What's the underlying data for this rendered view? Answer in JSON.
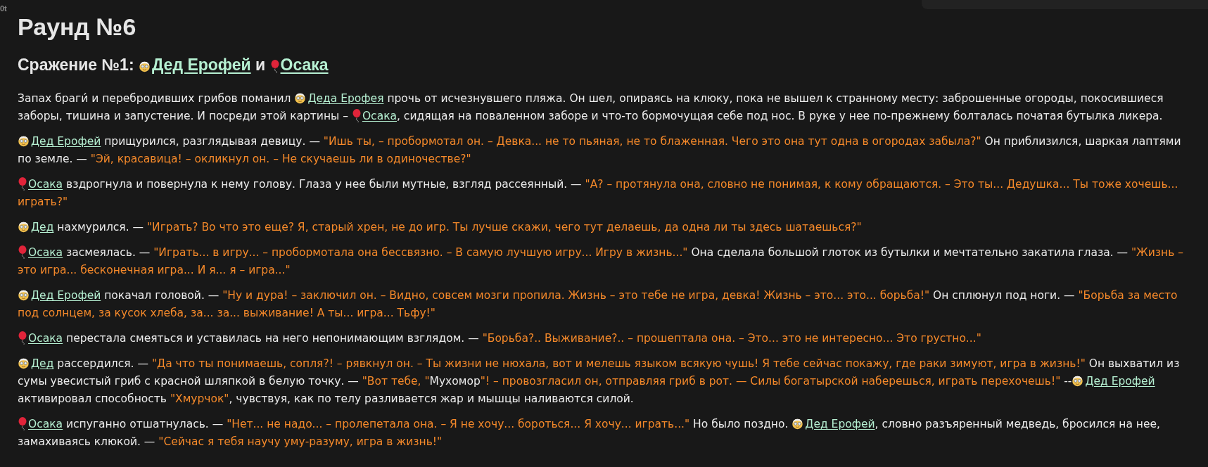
{
  "corner_text": "0t",
  "title": "Раунд №6",
  "battle": {
    "label": "Сражение №1:",
    "joiner": "и",
    "fighters": [
      {
        "name": "Дед Ерофей",
        "kind": "elder"
      },
      {
        "name": "Осака",
        "kind": "balloon"
      }
    ]
  },
  "paragraphs": [
    {
      "segments": [
        {
          "kind": "text",
          "text": "Запах браги́ и перебродивших грибов поманил "
        },
        {
          "kind": "elder",
          "text": "Деда Ерофея"
        },
        {
          "kind": "text",
          "text": " прочь от исчезнувшего пляжа. Он шел, опираясь на клюку, пока не вышел к странному месту: заброшенные огороды, покосившиеся заборы, тишина и запустение. И посреди этой картины – "
        },
        {
          "kind": "balloon",
          "text": "Осака"
        },
        {
          "kind": "text",
          "text": ", сидящая на поваленном заборе и что-то бормочущая себе под нос. В руке у нее по-прежнему болталась початая бутылка ликера."
        }
      ]
    },
    {
      "segments": [
        {
          "kind": "elder",
          "text": "Дед Ерофей"
        },
        {
          "kind": "text",
          "text": " прищурился, разглядывая девицу. — "
        },
        {
          "kind": "speech",
          "text": "\"Ишь ты, – пробормотал он. – Девка... не то пьяная, не то блаженная. Чего это она тут одна в огородах забыла?\""
        },
        {
          "kind": "text",
          "text": " Он приблизился, шаркая лаптями по земле. — "
        },
        {
          "kind": "speech",
          "text": "\"Эй, красавица! – окликнул он. – Не скучаешь ли в одиночестве?\""
        }
      ]
    },
    {
      "segments": [
        {
          "kind": "balloon",
          "text": "Осака"
        },
        {
          "kind": "text",
          "text": " вздрогнула и повернула к нему голову. Глаза у нее были мутные, взгляд рассеянный. — "
        },
        {
          "kind": "speech",
          "text": "\"А? – протянула она, словно не понимая, к кому обращаются. – Это ты... Дедушка... Ты тоже хочешь... играть?\""
        }
      ]
    },
    {
      "segments": [
        {
          "kind": "elder",
          "text": "Дед"
        },
        {
          "kind": "text",
          "text": " нахмурился. — "
        },
        {
          "kind": "speech",
          "text": "\"Играть? Во что это еще? Я, старый хрен, не до игр. Ты лучше скажи, чего тут делаешь, да одна ли ты здесь шатаешься?\""
        }
      ]
    },
    {
      "segments": [
        {
          "kind": "balloon",
          "text": "Осака"
        },
        {
          "kind": "text",
          "text": " засмеялась. — "
        },
        {
          "kind": "speech",
          "text": "\"Играть... в игру... – пробормотала она бессвязно. – В самую лучшую игру... Игру в жизнь...\""
        },
        {
          "kind": "text",
          "text": " Она сделала большой глоток из бутылки и мечтательно закатила глаза. — "
        },
        {
          "kind": "speech",
          "text": "\"Жизнь – это игра... бесконечная игра... И я... я – игра...\""
        }
      ]
    },
    {
      "segments": [
        {
          "kind": "elder",
          "text": "Дед Ерофей"
        },
        {
          "kind": "text",
          "text": " покачал головой. — "
        },
        {
          "kind": "speech",
          "text": "\"Ну и дура! – заключил он. – Видно, совсем мозги пропила. Жизнь – это тебе не игра, девка! Жизнь – это... это... борьба!\""
        },
        {
          "kind": "text",
          "text": " Он сплюнул под ноги. — "
        },
        {
          "kind": "speech",
          "text": "\"Борьба за место под солнцем, за кусок хлеба, за... за... выживание! А ты... игра... Тьфу!\""
        }
      ]
    },
    {
      "segments": [
        {
          "kind": "balloon",
          "text": "Осака"
        },
        {
          "kind": "text",
          "text": " перестала смеяться и уставилась на него непонимающим взглядом. — "
        },
        {
          "kind": "speech",
          "text": "\"Борьба?.. Выживание?.. – прошептала она. – Это... это не интересно... Это грустно...\""
        }
      ]
    },
    {
      "segments": [
        {
          "kind": "elder",
          "text": "Дед"
        },
        {
          "kind": "text",
          "text": " рассердился. — "
        },
        {
          "kind": "speech",
          "text": "\"Да что ты понимаешь, сопля?! – рявкнул он. – Ты жизни не нюхала, вот и мелешь языком всякую чушь! Я тебе сейчас покажу, где раки зимуют, игра в жизнь!\""
        },
        {
          "kind": "text",
          "text": " Он выхватил из сумы увесистый гриб с красной шляпкой в белую точку. — "
        },
        {
          "kind": "speech",
          "text": "\"Вот тебе, \""
        },
        {
          "kind": "text",
          "text": "Мухомор"
        },
        {
          "kind": "speech",
          "text": "\"! – провозгласил он, отправляя гриб в рот. — Силы богатырской наберешься, играть перехочешь!\""
        },
        {
          "kind": "text",
          "text": " --"
        },
        {
          "kind": "elder",
          "text": "Дед Ерофей"
        },
        {
          "kind": "text",
          "text": " активировал способность "
        },
        {
          "kind": "speech",
          "text": "\"Хмурчок\""
        },
        {
          "kind": "text",
          "text": ", чувствуя, как по телу разливается жар и мышцы наливаются силой."
        }
      ]
    },
    {
      "segments": [
        {
          "kind": "balloon",
          "text": "Осака"
        },
        {
          "kind": "text",
          "text": " испуганно отшатнулась. — "
        },
        {
          "kind": "speech",
          "text": "\"Нет... не надо... – пролепетала она. – Я не хочу... бороться... Я хочу... играть...\""
        },
        {
          "kind": "text",
          "text": " Но было поздно. "
        },
        {
          "kind": "elder",
          "text": "Дед Ерофей"
        },
        {
          "kind": "text",
          "text": ", словно разъяренный медведь, бросился на нее, замахиваясь клюкой. — "
        },
        {
          "kind": "speech",
          "text": "\"Сейчас я тебя научу уму-разуму, игра в жизнь!\""
        }
      ]
    }
  ]
}
